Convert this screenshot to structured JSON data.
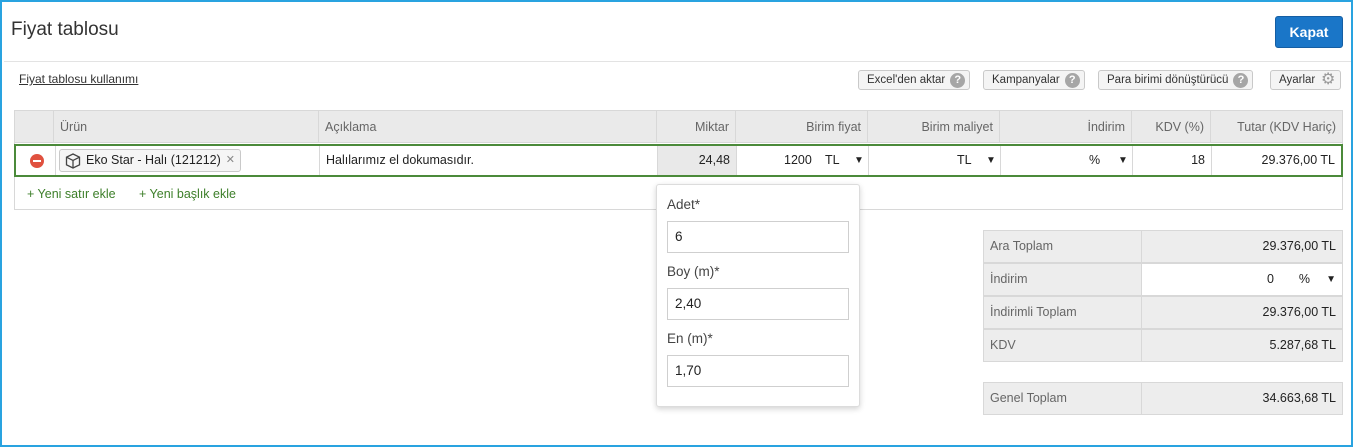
{
  "header": {
    "title": "Fiyat tablosu",
    "close_label": "Kapat"
  },
  "toolbar": {
    "usage_link": "Fiyat tablosu kullanımı",
    "excel_label": "Excel'den aktar",
    "campaigns_label": "Kampanyalar",
    "currency_converter_label": "Para birimi dönüştürücü",
    "settings_label": "Ayarlar",
    "help_glyph": "?"
  },
  "table": {
    "columns": {
      "product": "Ürün",
      "description": "Açıklama",
      "quantity": "Miktar",
      "unit_price": "Birim fiyat",
      "unit_cost": "Birim maliyet",
      "discount": "İndirim",
      "vat": "KDV (%)",
      "total": "Tutar (KDV Hariç)"
    },
    "rows": [
      {
        "product": "Eko Star - Halı (121212)",
        "description": "Halılarımız el dokumasıdır.",
        "quantity": "24,48",
        "unit_price": "1200",
        "unit_price_currency": "TL",
        "unit_cost_currency": "TL",
        "discount_unit": "%",
        "vat": "18",
        "total": "29.376,00 TL"
      }
    ],
    "add_row_label": "+ Yeni satır ekle",
    "add_header_label": "+ Yeni başlık ekle"
  },
  "quantity_popup": {
    "adet_label": "Adet*",
    "adet_value": "6",
    "boy_label": "Boy (m)*",
    "boy_value": "2,40",
    "en_label": "En (m)*",
    "en_value": "1,70"
  },
  "totals": {
    "subtotal_label": "Ara Toplam",
    "subtotal_value": "29.376,00 TL",
    "discount_label": "İndirim",
    "discount_value": "0",
    "discount_unit": "%",
    "discounted_total_label": "İndirimli Toplam",
    "discounted_total_value": "29.376,00 TL",
    "vat_label": "KDV",
    "vat_value": "5.287,68 TL",
    "grand_total_label": "Genel Toplam",
    "grand_total_value": "34.663,68 TL"
  },
  "colors": {
    "accent": "#1a76c8",
    "frame": "#29a3e0",
    "row_border": "#4b8a3a",
    "link_green": "#3d7f2a",
    "remove_red": "#e0513f"
  }
}
